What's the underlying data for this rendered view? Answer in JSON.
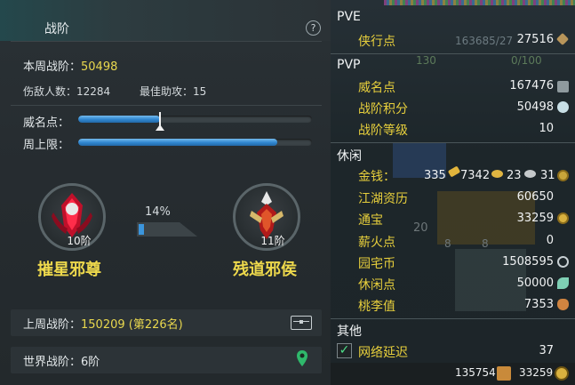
{
  "left": {
    "title": "战阶",
    "help_label": "?",
    "week_label": "本周战阶：",
    "week_value": "50498",
    "damage_label": "伤敌人数：",
    "damage_value": "12284",
    "assist_label": "最佳助攻：",
    "assist_value": "15",
    "fame_label": "威名点：",
    "fame_progress": 0.35,
    "cap_label": "周上限：",
    "cap_progress": 0.85,
    "current_rank": {
      "level": "10阶",
      "name": "摧星邪尊"
    },
    "next_rank": {
      "level": "11阶",
      "name": "残道邪侯"
    },
    "rank_progress_text": "14%",
    "rank_progress": 0.14,
    "last_week_label": "上周战阶：",
    "last_week_value": "150209 (第226名)",
    "world_label": "世界战阶：",
    "world_value": "6阶"
  },
  "right": {
    "pve": {
      "title": "PVE",
      "rows": [
        {
          "label": "侠行点",
          "value": "27516"
        }
      ]
    },
    "pvp": {
      "title": "PVP",
      "rows": [
        {
          "label": "威名点",
          "value": "167476"
        },
        {
          "label": "战阶积分",
          "value": "50498"
        },
        {
          "label": "战阶等级",
          "value": "10"
        }
      ]
    },
    "leisure": {
      "title": "休闲",
      "money_label": "金钱：",
      "money": [
        "335",
        "7342",
        "23",
        "31"
      ],
      "rows": [
        {
          "label": "江湖资历",
          "value": "60650"
        },
        {
          "label": "通宝",
          "value": "33259"
        },
        {
          "label": "薪火点",
          "value": "0"
        },
        {
          "label": "园宅币",
          "value": "1508595"
        },
        {
          "label": "休闲点",
          "value": "50000"
        },
        {
          "label": "桃李值",
          "value": "7353"
        }
      ]
    },
    "other": {
      "title": "其他",
      "latency_label": "网络延迟",
      "latency_value": "37",
      "latency_checked": true
    },
    "footer": {
      "value1": "135754",
      "value2": "33259"
    },
    "background_text": {
      "a": "163685/27",
      "b": "130",
      "c": "0/100",
      "d": "20",
      "e": "8",
      "f": "8"
    }
  },
  "colors": {
    "accent_yellow": "#e9d84e",
    "bar_blue": "#2f86cf",
    "label_gold": "#e7cf3c"
  }
}
